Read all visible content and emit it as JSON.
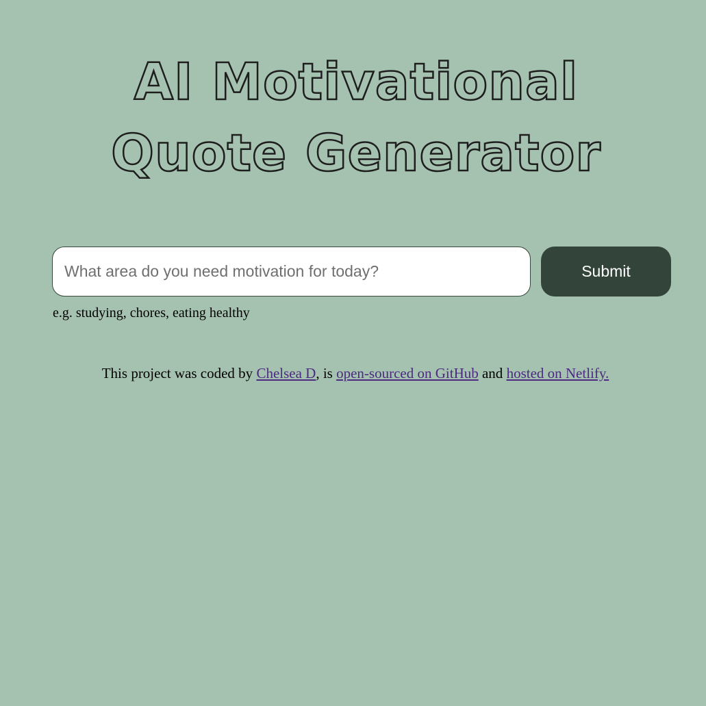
{
  "header": {
    "title": "AI Motivational Quote Generator"
  },
  "form": {
    "input_placeholder": "What area do you need motivation for today?",
    "input_value": "",
    "submit_label": "Submit",
    "hint": "e.g. studying, chores, eating healthy"
  },
  "footer": {
    "text_1": "This project was coded by ",
    "link_author": "Chelsea D",
    "text_2": ", is ",
    "link_github": "open-sourced on GitHub",
    "text_3": " and ",
    "link_netlify": "hosted on Netlify."
  },
  "colors": {
    "background": "#a5c2b0",
    "button": "#33453a",
    "link": "#4b2a80"
  }
}
